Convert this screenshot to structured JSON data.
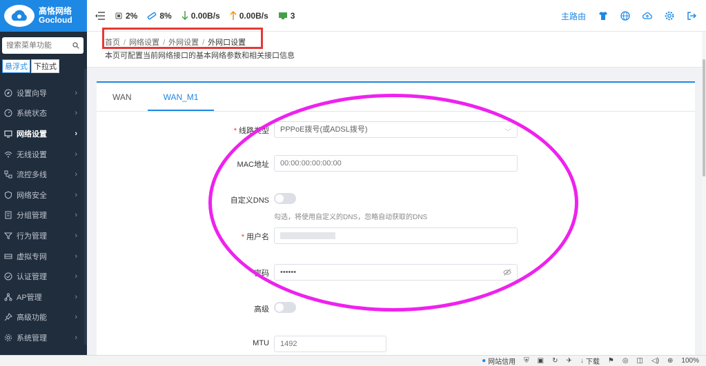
{
  "brand": {
    "name_cn": "高恪网络",
    "name_en": "Gocloud"
  },
  "sidebar": {
    "search_placeholder": "搜索菜单功能",
    "modes": [
      "悬浮式",
      "下拉式"
    ],
    "items": [
      {
        "label": "设置向导",
        "icon": "compass-icon"
      },
      {
        "label": "系统状态",
        "icon": "gauge-icon"
      },
      {
        "label": "网络设置",
        "icon": "monitor-icon"
      },
      {
        "label": "无线设置",
        "icon": "wifi-icon"
      },
      {
        "label": "流控多线",
        "icon": "network-icon"
      },
      {
        "label": "网络安全",
        "icon": "shield-icon"
      },
      {
        "label": "分组管理",
        "icon": "document-icon"
      },
      {
        "label": "行为管理",
        "icon": "filter-icon"
      },
      {
        "label": "虚拟专网",
        "icon": "vpn-icon"
      },
      {
        "label": "认证管理",
        "icon": "check-shield-icon"
      },
      {
        "label": "AP管理",
        "icon": "ap-icon"
      },
      {
        "label": "高级功能",
        "icon": "pin-icon"
      },
      {
        "label": "系统管理",
        "icon": "gear-icon"
      }
    ]
  },
  "header": {
    "cpu": "2%",
    "mem": "8%",
    "down": "0.00B/s",
    "up": "0.00B/s",
    "devices": "3",
    "main_router": "主路由"
  },
  "breadcrumb": {
    "items": [
      "首页",
      "网络设置",
      "外网设置",
      "外网口设置"
    ],
    "separator": "/",
    "description": "本页可配置当前网络接口的基本网络参数和相关接口信息"
  },
  "tabs": [
    "WAN",
    "WAN_M1"
  ],
  "form": {
    "line_type_label": "线路类型",
    "line_type_value": "PPPoE拨号(或ADSL拨号)",
    "mac_label": "MAC地址",
    "mac_placeholder": "00:00:00:00:00:00",
    "custom_dns_label": "自定义DNS",
    "custom_dns_hint": "勾选，将使用自定义的DNS，忽略自动获取的DNS",
    "username_label": "用户名",
    "password_label": "密码",
    "password_value": "••••••",
    "advanced_label": "高级",
    "mtu_label": "MTU",
    "mtu_placeholder": "1492"
  },
  "statusbar": {
    "items": [
      "网站信用",
      "下载",
      "100%"
    ]
  },
  "colors": {
    "accent": "#1e88e5",
    "sidebar_bg": "#1f2d3d",
    "annotation_red": "#e53935",
    "annotation_magenta": "#ee22ee"
  }
}
